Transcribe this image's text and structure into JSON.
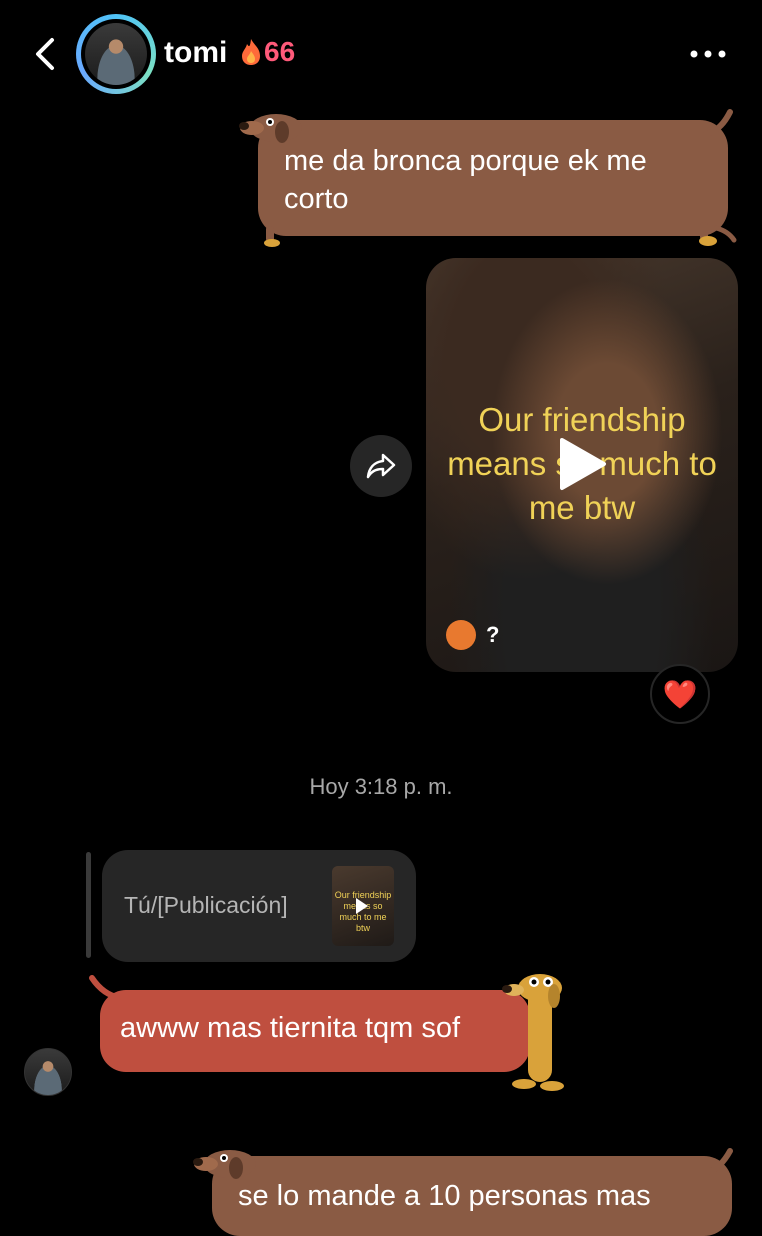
{
  "header": {
    "username": "tomi",
    "streak_count": "66",
    "streak_icon": "fire-icon",
    "more_icon": "more-horizontal-icon",
    "back_icon": "chevron-left-icon"
  },
  "messages": {
    "sent_1": "me da bronca porque ek me corto",
    "video": {
      "caption": "Our friendship means so much to me btw",
      "author_label": "?",
      "reaction": "❤️"
    },
    "timestamp": "Hoy 3:18 p. m.",
    "reply_quote": {
      "label": "Tú/[Publicación]",
      "thumb_caption": "Our friendship means so much to me btw"
    },
    "received_1": "awww mas tiernita tqm sof",
    "sent_2": "se lo mande a 10 personas mas"
  },
  "colors": {
    "sent_bubble": "#8a5b44",
    "received_bubble": "#bf4f3f",
    "video_caption": "#f0d257",
    "streak": "#ff5a7a"
  }
}
